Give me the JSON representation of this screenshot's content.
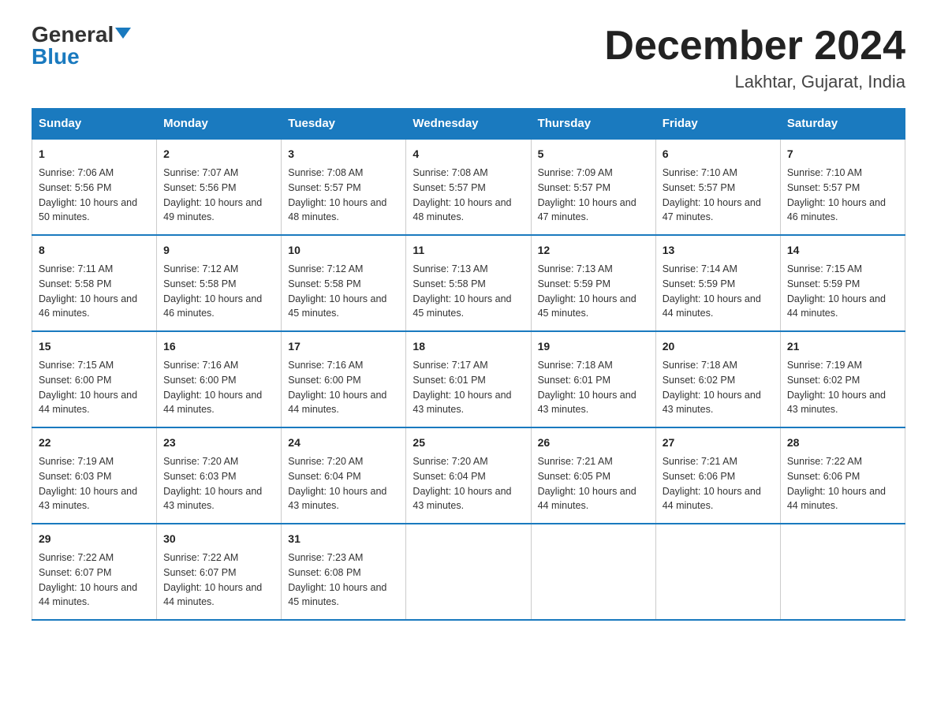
{
  "logo": {
    "general": "General",
    "blue": "Blue"
  },
  "title": "December 2024",
  "location": "Lakhtar, Gujarat, India",
  "days_of_week": [
    "Sunday",
    "Monday",
    "Tuesday",
    "Wednesday",
    "Thursday",
    "Friday",
    "Saturday"
  ],
  "weeks": [
    [
      {
        "day": "1",
        "sunrise": "7:06 AM",
        "sunset": "5:56 PM",
        "daylight": "10 hours and 50 minutes."
      },
      {
        "day": "2",
        "sunrise": "7:07 AM",
        "sunset": "5:56 PM",
        "daylight": "10 hours and 49 minutes."
      },
      {
        "day": "3",
        "sunrise": "7:08 AM",
        "sunset": "5:57 PM",
        "daylight": "10 hours and 48 minutes."
      },
      {
        "day": "4",
        "sunrise": "7:08 AM",
        "sunset": "5:57 PM",
        "daylight": "10 hours and 48 minutes."
      },
      {
        "day": "5",
        "sunrise": "7:09 AM",
        "sunset": "5:57 PM",
        "daylight": "10 hours and 47 minutes."
      },
      {
        "day": "6",
        "sunrise": "7:10 AM",
        "sunset": "5:57 PM",
        "daylight": "10 hours and 47 minutes."
      },
      {
        "day": "7",
        "sunrise": "7:10 AM",
        "sunset": "5:57 PM",
        "daylight": "10 hours and 46 minutes."
      }
    ],
    [
      {
        "day": "8",
        "sunrise": "7:11 AM",
        "sunset": "5:58 PM",
        "daylight": "10 hours and 46 minutes."
      },
      {
        "day": "9",
        "sunrise": "7:12 AM",
        "sunset": "5:58 PM",
        "daylight": "10 hours and 46 minutes."
      },
      {
        "day": "10",
        "sunrise": "7:12 AM",
        "sunset": "5:58 PM",
        "daylight": "10 hours and 45 minutes."
      },
      {
        "day": "11",
        "sunrise": "7:13 AM",
        "sunset": "5:58 PM",
        "daylight": "10 hours and 45 minutes."
      },
      {
        "day": "12",
        "sunrise": "7:13 AM",
        "sunset": "5:59 PM",
        "daylight": "10 hours and 45 minutes."
      },
      {
        "day": "13",
        "sunrise": "7:14 AM",
        "sunset": "5:59 PM",
        "daylight": "10 hours and 44 minutes."
      },
      {
        "day": "14",
        "sunrise": "7:15 AM",
        "sunset": "5:59 PM",
        "daylight": "10 hours and 44 minutes."
      }
    ],
    [
      {
        "day": "15",
        "sunrise": "7:15 AM",
        "sunset": "6:00 PM",
        "daylight": "10 hours and 44 minutes."
      },
      {
        "day": "16",
        "sunrise": "7:16 AM",
        "sunset": "6:00 PM",
        "daylight": "10 hours and 44 minutes."
      },
      {
        "day": "17",
        "sunrise": "7:16 AM",
        "sunset": "6:00 PM",
        "daylight": "10 hours and 44 minutes."
      },
      {
        "day": "18",
        "sunrise": "7:17 AM",
        "sunset": "6:01 PM",
        "daylight": "10 hours and 43 minutes."
      },
      {
        "day": "19",
        "sunrise": "7:18 AM",
        "sunset": "6:01 PM",
        "daylight": "10 hours and 43 minutes."
      },
      {
        "day": "20",
        "sunrise": "7:18 AM",
        "sunset": "6:02 PM",
        "daylight": "10 hours and 43 minutes."
      },
      {
        "day": "21",
        "sunrise": "7:19 AM",
        "sunset": "6:02 PM",
        "daylight": "10 hours and 43 minutes."
      }
    ],
    [
      {
        "day": "22",
        "sunrise": "7:19 AM",
        "sunset": "6:03 PM",
        "daylight": "10 hours and 43 minutes."
      },
      {
        "day": "23",
        "sunrise": "7:20 AM",
        "sunset": "6:03 PM",
        "daylight": "10 hours and 43 minutes."
      },
      {
        "day": "24",
        "sunrise": "7:20 AM",
        "sunset": "6:04 PM",
        "daylight": "10 hours and 43 minutes."
      },
      {
        "day": "25",
        "sunrise": "7:20 AM",
        "sunset": "6:04 PM",
        "daylight": "10 hours and 43 minutes."
      },
      {
        "day": "26",
        "sunrise": "7:21 AM",
        "sunset": "6:05 PM",
        "daylight": "10 hours and 44 minutes."
      },
      {
        "day": "27",
        "sunrise": "7:21 AM",
        "sunset": "6:06 PM",
        "daylight": "10 hours and 44 minutes."
      },
      {
        "day": "28",
        "sunrise": "7:22 AM",
        "sunset": "6:06 PM",
        "daylight": "10 hours and 44 minutes."
      }
    ],
    [
      {
        "day": "29",
        "sunrise": "7:22 AM",
        "sunset": "6:07 PM",
        "daylight": "10 hours and 44 minutes."
      },
      {
        "day": "30",
        "sunrise": "7:22 AM",
        "sunset": "6:07 PM",
        "daylight": "10 hours and 44 minutes."
      },
      {
        "day": "31",
        "sunrise": "7:23 AM",
        "sunset": "6:08 PM",
        "daylight": "10 hours and 45 minutes."
      },
      null,
      null,
      null,
      null
    ]
  ],
  "labels": {
    "sunrise_prefix": "Sunrise: ",
    "sunset_prefix": "Sunset: ",
    "daylight_prefix": "Daylight: "
  }
}
